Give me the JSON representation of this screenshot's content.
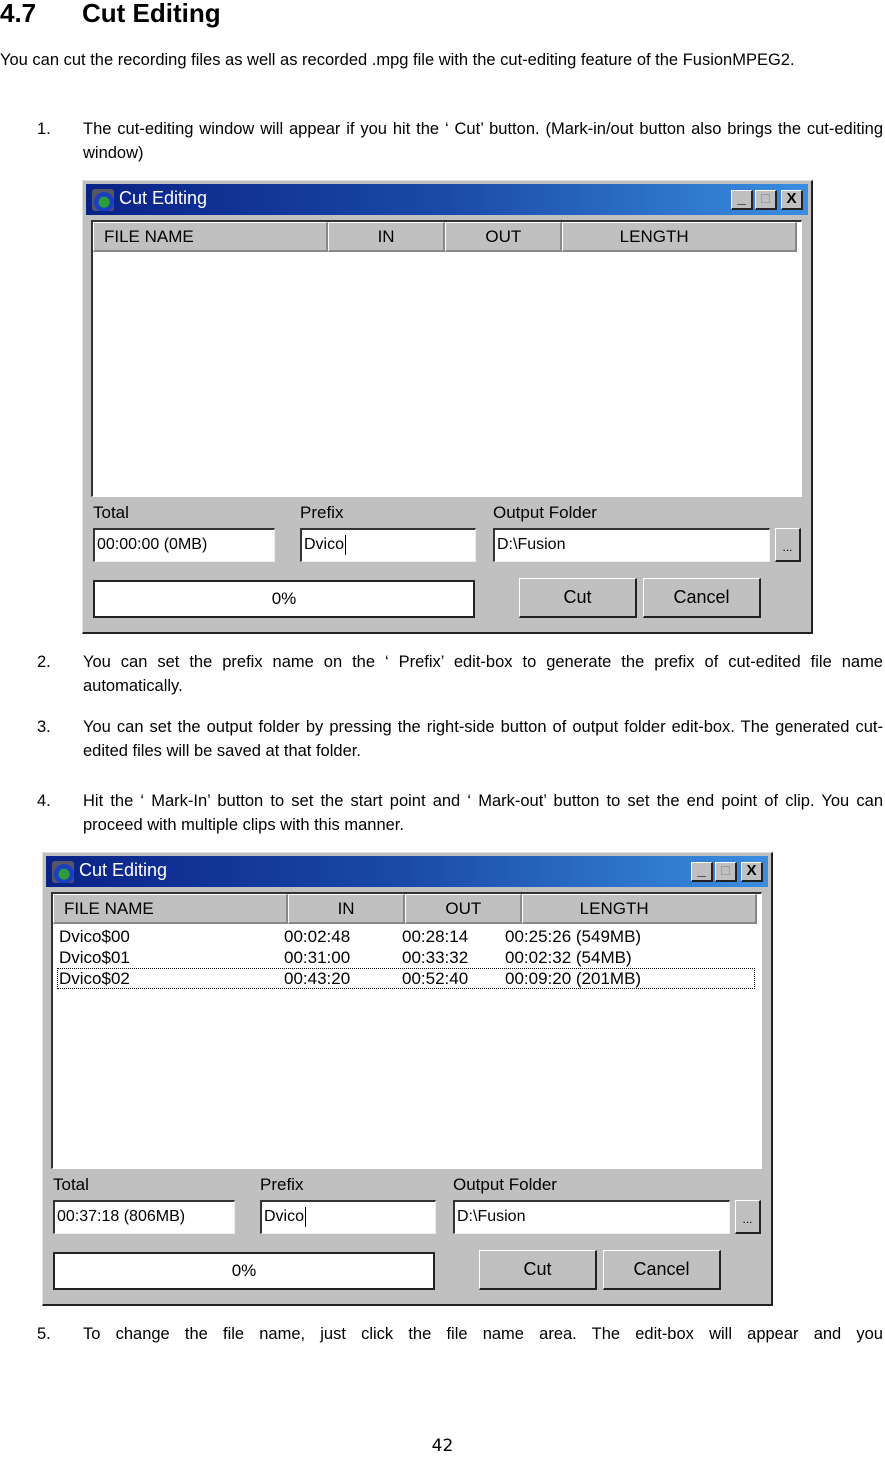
{
  "section": {
    "number": "4.7",
    "title": "Cut Editing"
  },
  "intro": "You can cut the recording files as well as recorded .mpg file with the cut-editing feature of the FusionMPEG2.",
  "steps": [
    {
      "num": "1.",
      "text": "The cut-editing window will appear if you hit the ‘ Cut’  button. (Mark-in/out button also brings the cut-editing window)"
    },
    {
      "num": "2.",
      "text": "You can set the prefix name on the ‘ Prefix’  edit-box to generate the prefix of cut-edited file name automatically."
    },
    {
      "num": "3.",
      "text": "You can set the output folder by pressing the right-side button of output folder edit-box. The generated cut-edited files will be saved at that folder."
    },
    {
      "num": "4.",
      "text": "Hit the ‘ Mark-In’  button to set the start point and ‘ Mark-out’  button to set the end point of clip. You can proceed with multiple clips with this manner."
    },
    {
      "num": "5.",
      "text": "To change the file name, just click the file name area. The edit-box will appear and you"
    }
  ],
  "windows": [
    {
      "title": "Cut Editing",
      "controls": {
        "minimize": "_",
        "maximize": "□",
        "close": "X"
      },
      "columns": [
        "FILE NAME",
        "IN",
        "OUT",
        "LENGTH"
      ],
      "rows": [],
      "labels": {
        "total": "Total",
        "prefix": "Prefix",
        "output_folder": "Output Folder"
      },
      "total_value": "00:00:00 (0MB)",
      "prefix_value": "Dvico",
      "output_folder_value": "D:\\Fusion",
      "browse_label": "...",
      "progress": "0%",
      "cut_label": "Cut",
      "cancel_label": "Cancel"
    },
    {
      "title": "Cut Editing",
      "controls": {
        "minimize": "_",
        "maximize": "□",
        "close": "X"
      },
      "columns": [
        "FILE NAME",
        "IN",
        "OUT",
        "LENGTH"
      ],
      "rows": [
        {
          "name": "Dvico$00",
          "in": "00:02:48",
          "out": "00:28:14",
          "length": "00:25:26 (549MB)"
        },
        {
          "name": "Dvico$01",
          "in": "00:31:00",
          "out": "00:33:32",
          "length": "00:02:32 (54MB)"
        },
        {
          "name": "Dvico$02",
          "in": "00:43:20",
          "out": "00:52:40",
          "length": "00:09:20 (201MB)"
        }
      ],
      "labels": {
        "total": "Total",
        "prefix": "Prefix",
        "output_folder": "Output Folder"
      },
      "total_value": "00:37:18 (806MB)",
      "prefix_value": "Dvico",
      "output_folder_value": "D:\\Fusion",
      "browse_label": "...",
      "progress": "0%",
      "cut_label": "Cut",
      "cancel_label": "Cancel"
    }
  ],
  "page_number": "42"
}
